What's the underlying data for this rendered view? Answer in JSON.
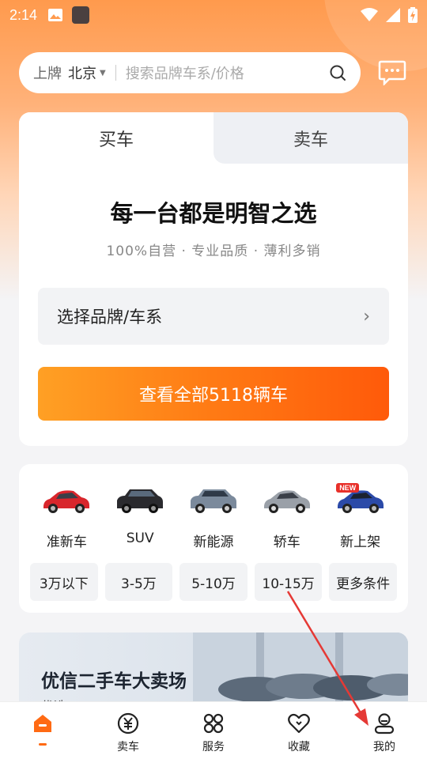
{
  "status_bar": {
    "time": "2:14"
  },
  "search": {
    "plate_label": "上牌",
    "city": "北京",
    "placeholder": "搜索品牌车系/价格"
  },
  "buy_card": {
    "tabs": [
      {
        "label": "买车",
        "active": true
      },
      {
        "label": "卖车",
        "active": false
      }
    ],
    "title": "每一台都是明智之选",
    "subtitle": "100%自营 · 专业品质 · 薄利多销",
    "brand_select": "选择品牌/车系",
    "view_all": "查看全部5118辆车"
  },
  "categories": {
    "items": [
      {
        "label": "准新车",
        "color": "#d8262c"
      },
      {
        "label": "SUV",
        "color": "#2a2a2e"
      },
      {
        "label": "新能源",
        "color": "#7b8a9c"
      },
      {
        "label": "轿车",
        "color": "#9aa0a8"
      },
      {
        "label": "新上架",
        "color": "#2b4aa8",
        "badge": "NEW"
      }
    ],
    "prices": [
      "3万以下",
      "3-5万",
      "5-10万",
      "10-15万",
      "更多条件"
    ]
  },
  "banner": {
    "title": "优信二手车大卖场",
    "subtitle": "优选"
  },
  "bottom_nav": {
    "items": [
      {
        "label": "",
        "icon": "home-icon",
        "active": true
      },
      {
        "label": "卖车",
        "icon": "yen-coin-icon"
      },
      {
        "label": "服务",
        "icon": "grid-services-icon"
      },
      {
        "label": "收藏",
        "icon": "heart-icon"
      },
      {
        "label": "我的",
        "icon": "user-icon"
      }
    ]
  },
  "colors": {
    "accent": "#ff6a13",
    "annotation_arrow": "#e53935"
  }
}
